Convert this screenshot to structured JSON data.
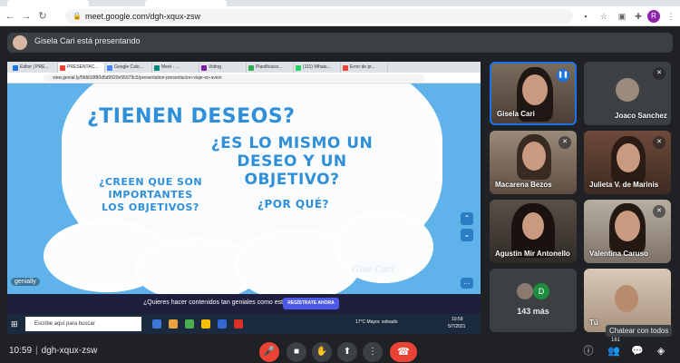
{
  "browser": {
    "url": "meet.google.com/dgh-xqux-zsw",
    "profile_initial": "R"
  },
  "presenting": {
    "text": "Gisela Cari está presentando"
  },
  "shared_screen": {
    "tabs": [
      {
        "label": "Editor | PRE...",
        "color": "#1a73e8"
      },
      {
        "label": "PRESENTAC...",
        "color": "#e94235",
        "active": true
      },
      {
        "label": "Google Calo...",
        "color": "#4285f4"
      },
      {
        "label": "Meet - ...",
        "color": "#00897b"
      },
      {
        "label": "Voting",
        "color": "#7b1fa2"
      },
      {
        "label": "Planificacio...",
        "color": "#34a853"
      },
      {
        "label": "(111) Whats...",
        "color": "#25d366"
      },
      {
        "label": "Error de pr...",
        "color": "#ea4335"
      }
    ],
    "url": "view.genial.ly/5fdd10f80d5d9920e55079c5/presentation-presentacion-viaje-en-avion",
    "slide": {
      "title1": "¿TIENEN DESEOS?",
      "title2": "¿ES LO MISMO UN DESEO Y UN OBJETIVO?",
      "question": "¿CREEN QUE SON IMPORTANTES LOS OBJETIVOS?",
      "why": "¿POR QUÉ?",
      "signature": "Gise Cari",
      "brand": "genially"
    },
    "banner": {
      "text": "¿Quieres hacer contenidos tan geniales como este?",
      "button": "REGÍSTRATE AHORA"
    },
    "taskbar": {
      "search": "Escribe aquí para buscar",
      "weather": "17°C Mayor. soleado",
      "time": "10:59",
      "date": "5/7/2021"
    }
  },
  "participants": [
    {
      "name": "Gisela Cari",
      "video": true,
      "speaking": true
    },
    {
      "name": "Joaco Sanchez",
      "video": false
    },
    {
      "name": "Macarena Bezos",
      "video": true
    },
    {
      "name": "Julieta V. de Marinis",
      "video": true
    },
    {
      "name": "Agustin Mir Antonello",
      "video": true
    },
    {
      "name": "Valentina Caruso",
      "video": true
    },
    {
      "name": "143 más",
      "video": false,
      "more_initial": "D"
    },
    {
      "name": "Tú",
      "video": true
    }
  ],
  "tooltip": "Chatear con todos",
  "bottom": {
    "time": "10:59",
    "meeting_code": "dgh-xqux-zsw",
    "people_count": "161"
  }
}
